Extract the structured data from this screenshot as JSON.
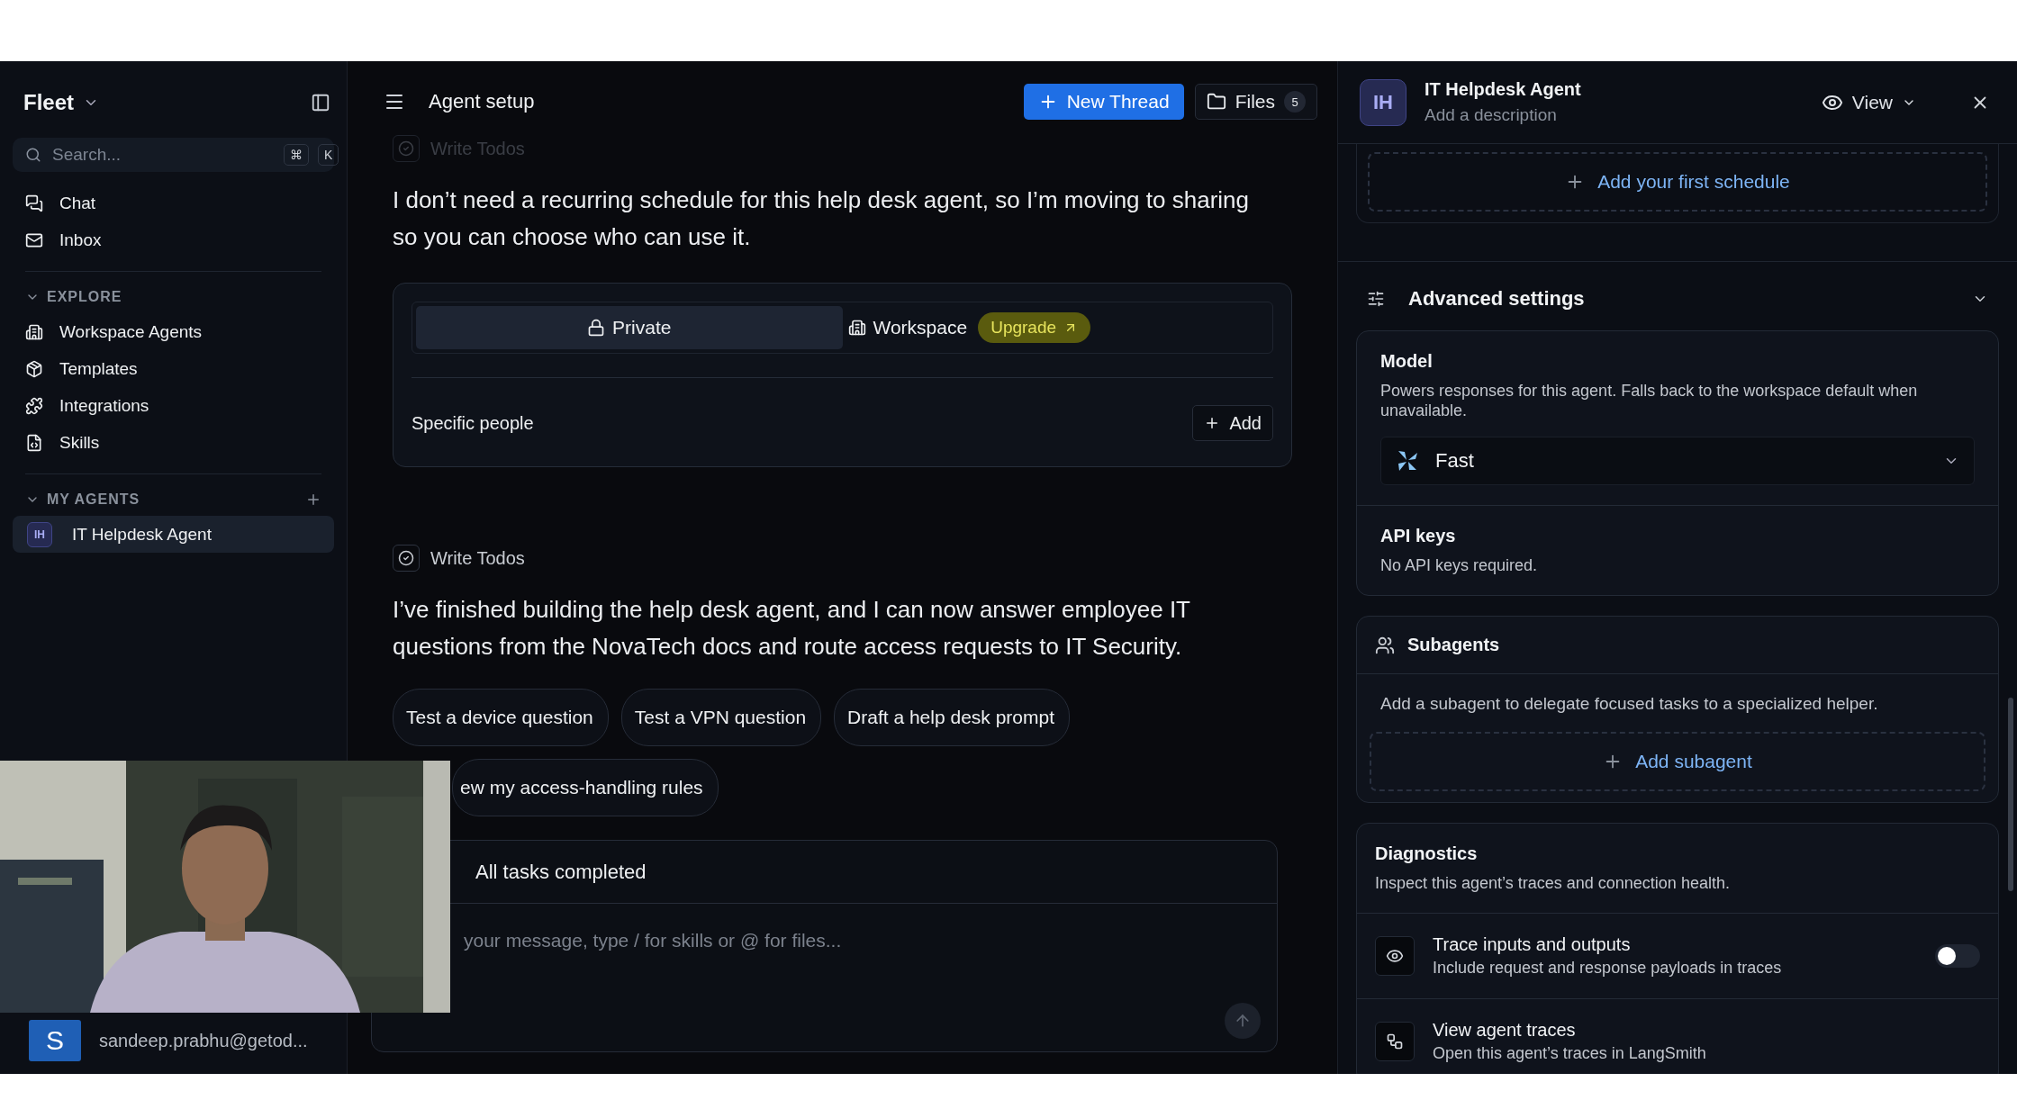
{
  "sidebar": {
    "workspace": "Fleet",
    "search": {
      "placeholder": "Search...",
      "keys": [
        "⌘",
        "K"
      ]
    },
    "nav": [
      {
        "kind": "chat",
        "label": "Chat"
      },
      {
        "kind": "inbox",
        "label": "Inbox"
      }
    ],
    "explore": {
      "title": "EXPLORE",
      "expanded": true,
      "items": [
        {
          "kind": "building",
          "label": "Workspace Agents"
        },
        {
          "kind": "package",
          "label": "Templates"
        },
        {
          "kind": "puzzle",
          "label": "Integrations"
        },
        {
          "kind": "file",
          "label": "Skills"
        }
      ]
    },
    "my_agents": {
      "title": "MY AGENTS",
      "expanded": true,
      "items": [
        {
          "initials": "IH",
          "label": "IT Helpdesk Agent",
          "selected": true
        }
      ]
    },
    "account": {
      "initial": "S",
      "email": "sandeep.prabhu@getod..."
    }
  },
  "main": {
    "title": "Agent setup",
    "new_thread": "New Thread",
    "files": {
      "label": "Files",
      "count": "5"
    },
    "messages": [
      {
        "kind": "tool",
        "label": "Write Todos",
        "faded": true
      },
      {
        "kind": "text",
        "text": "I don’t need a recurring schedule for this help desk agent, so I’m moving to sharing so you can choose who can use it."
      },
      {
        "kind": "sharing",
        "options": [
          {
            "kind": "lock",
            "label": "Private",
            "selected": true
          },
          {
            "kind": "building",
            "label": "Workspace",
            "selected": false,
            "badge": "Upgrade"
          }
        ],
        "people_label": "Specific people",
        "add": "Add"
      },
      {
        "kind": "tool",
        "label": "Write Todos",
        "faded": false
      },
      {
        "kind": "text",
        "text": "I’ve finished building the help desk agent, and I can now answer employee IT questions from the NovaTech docs and route access requests to IT Security."
      },
      {
        "kind": "chips",
        "chips": [
          "Test a device question",
          "Test a VPN question",
          "Draft a help desk prompt",
          "ew my access-handling rules"
        ]
      }
    ],
    "composer": {
      "status": "All tasks completed",
      "placeholder": "your message, type / for skills or @ for files..."
    }
  },
  "panel": {
    "agent": {
      "initials": "IH",
      "name": "IT Helpdesk Agent",
      "description": "Add a description"
    },
    "view": "View",
    "schedule_button": "Add your first schedule",
    "advanced": {
      "title": "Advanced settings",
      "expanded": true
    },
    "model": {
      "title": "Model",
      "description": "Powers responses for this agent. Falls back to the workspace default when unavailable.",
      "value": "Fast"
    },
    "api_keys": {
      "title": "API keys",
      "description": "No API keys required."
    },
    "subagents": {
      "title": "Subagents",
      "description": "Add a subagent to delegate focused tasks to a specialized helper.",
      "add": "Add subagent"
    },
    "diagnostics": {
      "title": "Diagnostics",
      "description": "Inspect this agent’s traces and connection health.",
      "rows": [
        {
          "kind": "toggle",
          "title": "Trace inputs and outputs",
          "description": "Include request and response payloads in traces",
          "on": false
        },
        {
          "kind": "link",
          "title": "View agent traces",
          "description": "Open this agent’s traces in LangSmith"
        }
      ]
    }
  }
}
